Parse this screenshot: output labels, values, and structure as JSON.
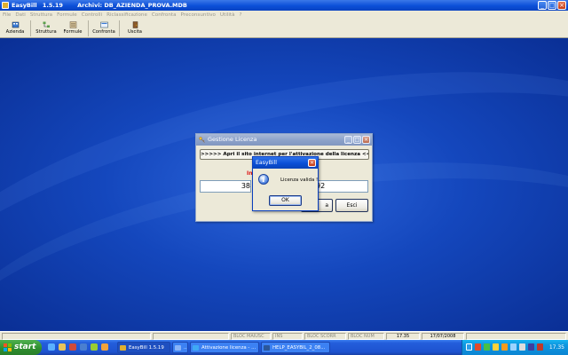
{
  "app": {
    "name": "EasyBill",
    "version": "1.5.19",
    "archive_label": "Archivi: DB_AZIENDA_PROVA.MDB"
  },
  "menu": [
    "File",
    "Dati",
    "Struttura",
    "Formule",
    "Controlli",
    "Riclassificazione",
    "Confronta",
    "Preconsuntivo",
    "Utilità",
    "?"
  ],
  "toolbar": [
    {
      "label": "Azienda",
      "icon": "building-icon"
    },
    {
      "label": "Struttura",
      "icon": "structure-icon"
    },
    {
      "label": "Formule",
      "icon": "formula-icon"
    },
    {
      "label": "Confronta",
      "icon": "compare-icon"
    },
    {
      "label": "Uscita",
      "icon": "exit-icon"
    }
  ],
  "license_dialog": {
    "title": "Gestione Licenza",
    "link_text": ">>>>>   Apri il sito internet per l'attivazione della licenza   <<<<<",
    "red_label_partial": "In",
    "code_left_partial": "38",
    "code_right_partial": "92",
    "hidden_button_partial": "a",
    "exit_button": "Esci"
  },
  "message_box": {
    "title": "EasyBill",
    "text": "Licenza valida !",
    "ok_button": "OK",
    "icon": "info-icon"
  },
  "statusbar": {
    "caps": "BLOC MAIUSC",
    "ins": "INS",
    "scroll": "BLOC SCORR",
    "num": "BLOC NUM",
    "time": "17.35",
    "date": "17/07/2008"
  },
  "taskbar": {
    "start": "start",
    "tasks": [
      {
        "label": "EasyBill    1.5.19",
        "icon": "easybill-icon",
        "active": true
      },
      {
        "label": "...",
        "icon": "app-icon",
        "active": false
      },
      {
        "label": "Attivazione licenza - ...",
        "icon": "ie-icon",
        "active": false
      },
      {
        "label": "HELP_EASYBIL_2_08...",
        "icon": "word-icon",
        "active": false
      }
    ],
    "clock": "17.35"
  },
  "colors": {
    "desktop": "#0b3fa8",
    "taskbar": "#245edb",
    "start_green": "#2f8f2f",
    "xp_title_blue": "#0a4fd7",
    "inactive_title": "#8aa0c8",
    "red_text": "#dd1111"
  }
}
